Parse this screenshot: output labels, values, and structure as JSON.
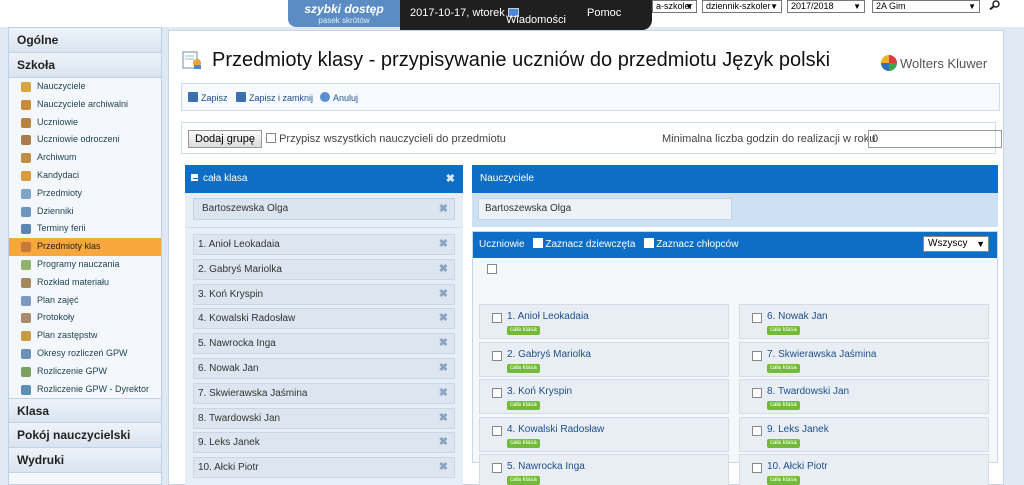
{
  "topbar": {
    "brand_title": "szybki dostęp",
    "brand_sub": "pasek skrótów",
    "date": "2017-10-17, wtorek",
    "messages": "Wiadomości",
    "help": "Pomoc",
    "selects": [
      "a-szkoler",
      "dziennik-szkoler",
      "2017/2018",
      "2A Gim"
    ]
  },
  "sidebar": {
    "sections": {
      "general": "Ogólne",
      "school": "Szkoła",
      "class": "Klasa",
      "teachers_room": "Pokój nauczycielski",
      "printouts": "Wydruki"
    },
    "items": [
      "Nauczyciele",
      "Nauczyciele archiwalni",
      "Uczniowie",
      "Uczniowie odroczeni",
      "Archiwum",
      "Kandydaci",
      "Przedmioty",
      "Dzienniki",
      "Terminy ferii",
      "Przedmioty klas",
      "Programy nauczania",
      "Rozkład materiału",
      "Plan zajęć",
      "Protokoły",
      "Plan zastępstw",
      "Okresy rozliczeń GPW",
      "Rozliczenie GPW",
      "Rozliczenie GPW - Dyrektor"
    ],
    "active_index": 9
  },
  "main": {
    "title": "Przedmioty klasy - przypisywanie uczniów do przedmiotu Język polski",
    "publisher": "Wolters Kluwer",
    "toolbar": {
      "save": "Zapisz",
      "save_close": "Zapisz i zamknij",
      "cancel": "Anuluj"
    },
    "add_group": "Dodaj grupę",
    "assign_all": "Przypisz wszystkich nauczycieli do przedmiotu",
    "min_hours_label": "Minimalna liczba godzin do realizacji w roku",
    "min_hours_value": "0"
  },
  "group": {
    "name": "cała klasa",
    "teacher": "Bartoszewska Olga",
    "students": [
      "1. Anioł Leokadaia",
      "2. Gabryś Mariolka",
      "3. Koń Kryspin",
      "4. Kowalski Radosław",
      "5. Nawrocka Inga",
      "6. Nowak Jan",
      "7. Skwierawska Jaśmina",
      "8. Twardowski Jan",
      "9. Leks Janek",
      "10. Ałcki Piotr"
    ]
  },
  "teachers_panel": {
    "title": "Nauczyciele",
    "teacher": "Bartoszewska Olga"
  },
  "students_panel": {
    "title": "Uczniowie",
    "check_girls": "Zaznacz dziewczęta",
    "check_boys": "Zaznacz chłopców",
    "filter": "Wszyscy",
    "tag": "cała klasa",
    "col1": [
      "1. Anioł Leokadaia",
      "2. Gabryś Mariolka",
      "3. Koń Kryspin",
      "4. Kowalski Radosław",
      "5. Nawrocka Inga"
    ],
    "col2": [
      "6. Nowak Jan",
      "7. Skwierawska Jaśmina",
      "8. Twardowski Jan",
      "9. Leks Janek",
      "10. Ałcki Piotr"
    ]
  }
}
